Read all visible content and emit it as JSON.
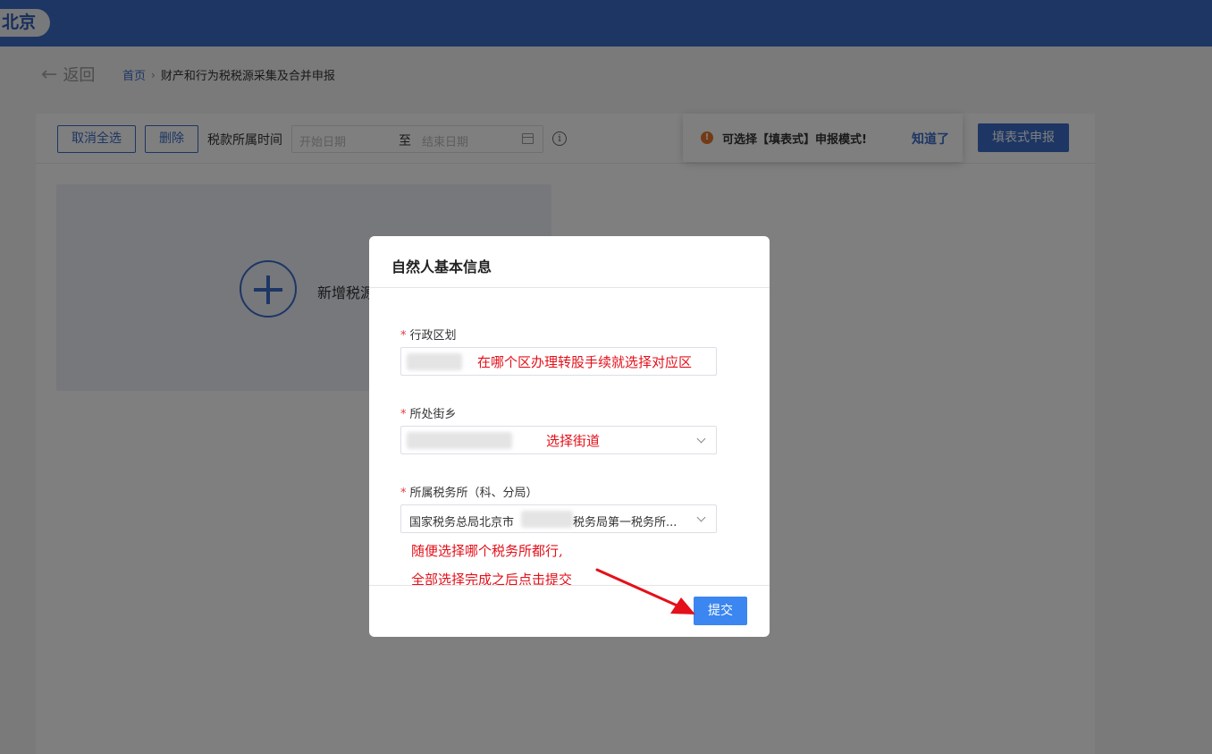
{
  "header": {
    "region": "北京"
  },
  "nav": {
    "back_label": "返回",
    "breadcrumb_home": "首页",
    "breadcrumb_sep": "›",
    "breadcrumb_current": "财产和行为税税源采集及合并申报"
  },
  "toolbar": {
    "deselect_all": "取消全选",
    "delete": "删除",
    "time_label": "税款所属时间",
    "start_placeholder": "开始日期",
    "range_to": "至",
    "end_placeholder": "结束日期",
    "info_glyph": "i",
    "fill_form_button": "填表式申报"
  },
  "notice": {
    "icon_glyph": "!",
    "message": "可选择【填表式】申报模式!",
    "ack": "知道了"
  },
  "add_card": {
    "label": "新增税源"
  },
  "modal": {
    "title": "自然人基本信息",
    "required_mark": "*",
    "fields": [
      {
        "label": "行政区划",
        "annotation": "在哪个区办理转股手续就选择对应区"
      },
      {
        "label": "所处街乡",
        "annotation": "选择街道"
      },
      {
        "label": "所属税务所（科、分局）",
        "value_prefix": "国家税务总局北京市",
        "value_suffix": "税务局第一税务所..."
      }
    ],
    "annotation_line1": "随便选择哪个税务所都行,",
    "annotation_line2": "全部选择完成之后点击提交",
    "submit": "提交"
  },
  "colors": {
    "primary": "#3b6cc8",
    "submit": "#3b86f0",
    "annotation": "#e4101a",
    "warning": "#e6762a"
  }
}
